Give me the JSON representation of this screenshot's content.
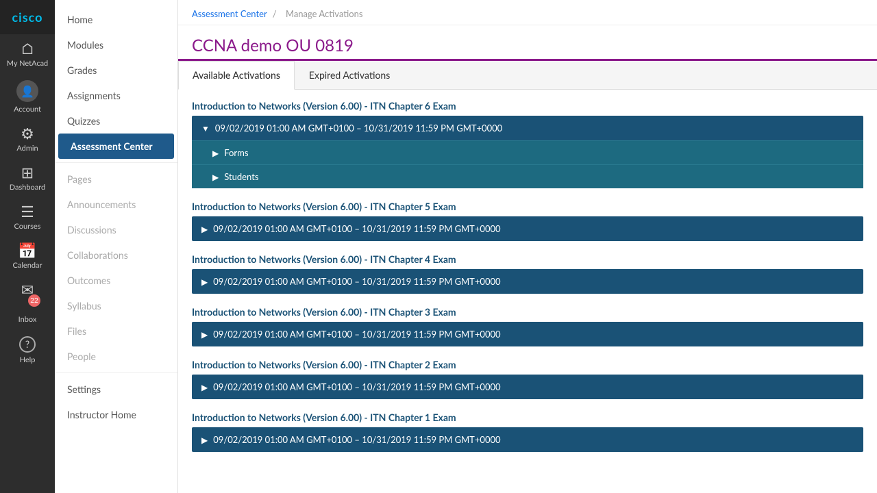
{
  "cisco": {
    "logo": "cisco"
  },
  "iconBar": {
    "items": [
      {
        "id": "home",
        "icon": "⌂",
        "label": "My NetAcad"
      },
      {
        "id": "account",
        "icon": "👤",
        "label": "Account"
      },
      {
        "id": "admin",
        "icon": "⚙",
        "label": "Admin"
      },
      {
        "id": "dashboard",
        "icon": "⊞",
        "label": "Dashboard"
      },
      {
        "id": "courses",
        "icon": "≡",
        "label": "Courses"
      },
      {
        "id": "calendar",
        "icon": "📅",
        "label": "Calendar"
      },
      {
        "id": "inbox",
        "icon": "✉",
        "label": "Inbox",
        "badge": "22"
      },
      {
        "id": "help",
        "icon": "?",
        "label": "Help"
      }
    ]
  },
  "nav": {
    "items": [
      {
        "id": "home",
        "label": "Home",
        "active": false,
        "dimmed": false
      },
      {
        "id": "modules",
        "label": "Modules",
        "active": false,
        "dimmed": false
      },
      {
        "id": "grades",
        "label": "Grades",
        "active": false,
        "dimmed": false
      },
      {
        "id": "assignments",
        "label": "Assignments",
        "active": false,
        "dimmed": false
      },
      {
        "id": "quizzes",
        "label": "Quizzes",
        "active": false,
        "dimmed": false
      },
      {
        "id": "assessment-center",
        "label": "Assessment Center",
        "active": true,
        "dimmed": false
      },
      {
        "id": "pages",
        "label": "Pages",
        "active": false,
        "dimmed": true
      },
      {
        "id": "announcements",
        "label": "Announcements",
        "active": false,
        "dimmed": true
      },
      {
        "id": "discussions",
        "label": "Discussions",
        "active": false,
        "dimmed": true
      },
      {
        "id": "collaborations",
        "label": "Collaborations",
        "active": false,
        "dimmed": true
      },
      {
        "id": "outcomes",
        "label": "Outcomes",
        "active": false,
        "dimmed": true
      },
      {
        "id": "syllabus",
        "label": "Syllabus",
        "active": false,
        "dimmed": true
      },
      {
        "id": "files",
        "label": "Files",
        "active": false,
        "dimmed": true
      },
      {
        "id": "people",
        "label": "People",
        "active": false,
        "dimmed": true
      },
      {
        "id": "settings",
        "label": "Settings",
        "active": false,
        "dimmed": false
      },
      {
        "id": "instructor-home",
        "label": "Instructor Home",
        "active": false,
        "dimmed": false
      }
    ]
  },
  "breadcrumb": {
    "link": "Assessment Center",
    "separator": "/",
    "current": "Manage Activations"
  },
  "page": {
    "title": "CCNA demo OU 0819"
  },
  "tabs": [
    {
      "id": "available",
      "label": "Available Activations",
      "active": true
    },
    {
      "id": "expired",
      "label": "Expired Activations",
      "active": false
    }
  ],
  "exams": [
    {
      "id": "ch6",
      "title": "Introduction to Networks (Version 6.00) - ITN Chapter 6 Exam",
      "expanded": true,
      "dateRange": "09/02/2019 01:00 AM GMT+0100 – 10/31/2019 11:59 PM GMT+0000",
      "subItems": [
        {
          "id": "forms",
          "label": "Forms"
        },
        {
          "id": "students",
          "label": "Students"
        }
      ]
    },
    {
      "id": "ch5",
      "title": "Introduction to Networks (Version 6.00) - ITN Chapter 5 Exam",
      "expanded": false,
      "dateRange": "09/02/2019 01:00 AM GMT+0100 – 10/31/2019 11:59 PM GMT+0000",
      "subItems": []
    },
    {
      "id": "ch4",
      "title": "Introduction to Networks (Version 6.00) - ITN Chapter 4 Exam",
      "expanded": false,
      "dateRange": "09/02/2019 01:00 AM GMT+0100 – 10/31/2019 11:59 PM GMT+0000",
      "subItems": []
    },
    {
      "id": "ch3",
      "title": "Introduction to Networks (Version 6.00) - ITN Chapter 3 Exam",
      "expanded": false,
      "dateRange": "09/02/2019 01:00 AM GMT+0100 – 10/31/2019 11:59 PM GMT+0000",
      "subItems": []
    },
    {
      "id": "ch2",
      "title": "Introduction to Networks (Version 6.00) - ITN Chapter 2 Exam",
      "expanded": false,
      "dateRange": "09/02/2019 01:00 AM GMT+0100 – 10/31/2019 11:59 PM GMT+0000",
      "subItems": []
    },
    {
      "id": "ch1",
      "title": "Introduction to Networks (Version 6.00) - ITN Chapter 1 Exam",
      "expanded": false,
      "dateRange": "09/02/2019 01:00 AM GMT+0100 – 10/31/2019 11:59 PM GMT+0000",
      "subItems": []
    }
  ]
}
